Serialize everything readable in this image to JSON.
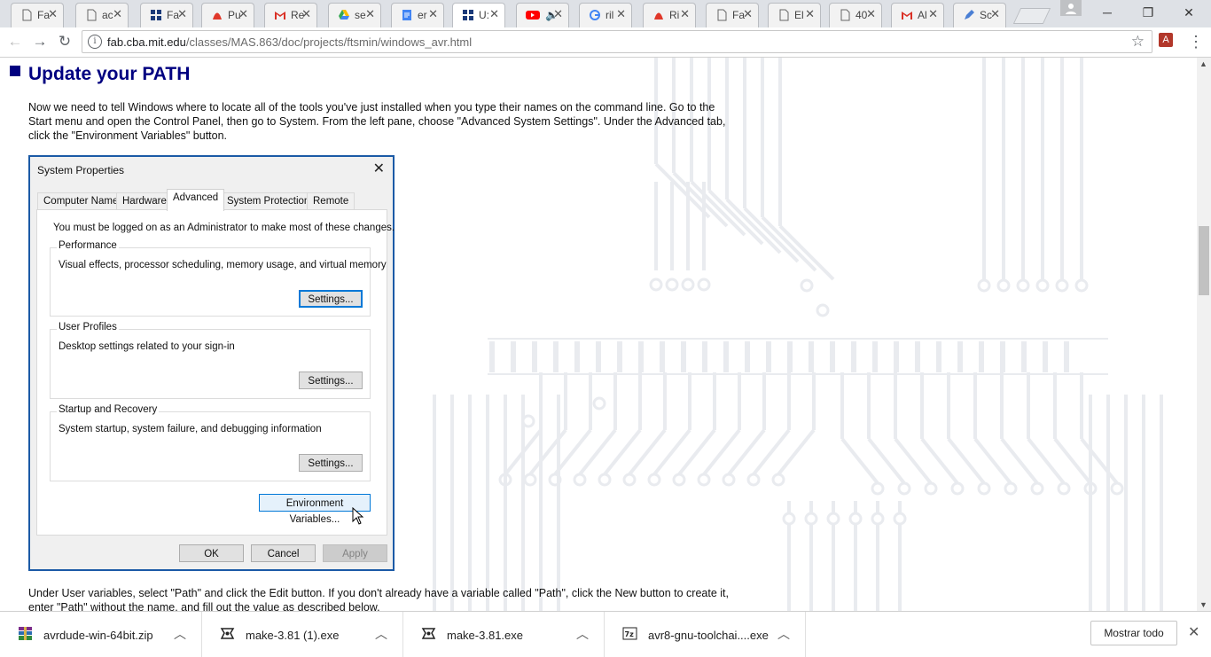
{
  "browser": {
    "tabs": [
      {
        "title": "Fa",
        "icon": "document-icon"
      },
      {
        "title": "ac",
        "icon": "document-icon"
      },
      {
        "title": "Fa",
        "icon": "grid-icon"
      },
      {
        "title": "Pu",
        "icon": "pdf-icon"
      },
      {
        "title": "Re",
        "icon": "gmail-icon"
      },
      {
        "title": "se",
        "icon": "drive-icon"
      },
      {
        "title": "er",
        "icon": "docs-icon"
      },
      {
        "title": "U:",
        "icon": "grid-icon"
      },
      {
        "title": "",
        "icon": "youtube-icon"
      },
      {
        "title": "ril",
        "icon": "google-icon"
      },
      {
        "title": "Ri",
        "icon": "pdf-icon"
      },
      {
        "title": "Fa",
        "icon": "document-icon"
      },
      {
        "title": "El",
        "icon": "document-icon"
      },
      {
        "title": "40",
        "icon": "document-icon"
      },
      {
        "title": "Al",
        "icon": "gmail-icon"
      },
      {
        "title": "Sc",
        "icon": "pencil-icon"
      }
    ],
    "active_tab_index": 7,
    "url_host": "fab.cba.mit.edu",
    "url_path": "/classes/MAS.863/doc/projects/ftsmin/windows_avr.html"
  },
  "page": {
    "heading": "Update your PATH",
    "intro": "Now we need to tell Windows where to locate all of the tools you've just installed when you type their names on the command line. Go to the Start menu and open the Control Panel, then go to System. From the left pane, choose \"Advanced System Settings\". Under the Advanced tab, click the \"Environment Variables\" button.",
    "after": "Under User variables, select \"Path\" and click the Edit button. If you don't already have a variable called \"Path\", click the New button to create it, enter \"Path\" without the name, and fill out the value as described below."
  },
  "dialog": {
    "title": "System Properties",
    "tabs": [
      "Computer Name",
      "Hardware",
      "Advanced",
      "System Protection",
      "Remote"
    ],
    "active_tab": "Advanced",
    "admin_note": "You must be logged on as an Administrator to make most of these changes.",
    "groups": [
      {
        "label": "Performance",
        "desc": "Visual effects, processor scheduling, memory usage, and virtual memory",
        "button": "Settings..."
      },
      {
        "label": "User Profiles",
        "desc": "Desktop settings related to your sign-in",
        "button": "Settings..."
      },
      {
        "label": "Startup and Recovery",
        "desc": "System startup, system failure, and debugging information",
        "button": "Settings..."
      }
    ],
    "env_button": "Environment Variables...",
    "ok": "OK",
    "cancel": "Cancel",
    "apply": "Apply"
  },
  "downloads": {
    "items": [
      {
        "name": "avrdude-win-64bit.zip",
        "icon": "winrar-archive-icon"
      },
      {
        "name": "make-3.81 (1).exe",
        "icon": "installer-icon"
      },
      {
        "name": "make-3.81.exe",
        "icon": "installer-icon"
      },
      {
        "name": "avr8-gnu-toolchai....exe",
        "icon": "7zip-icon"
      }
    ],
    "show_all": "Mostrar todo"
  }
}
